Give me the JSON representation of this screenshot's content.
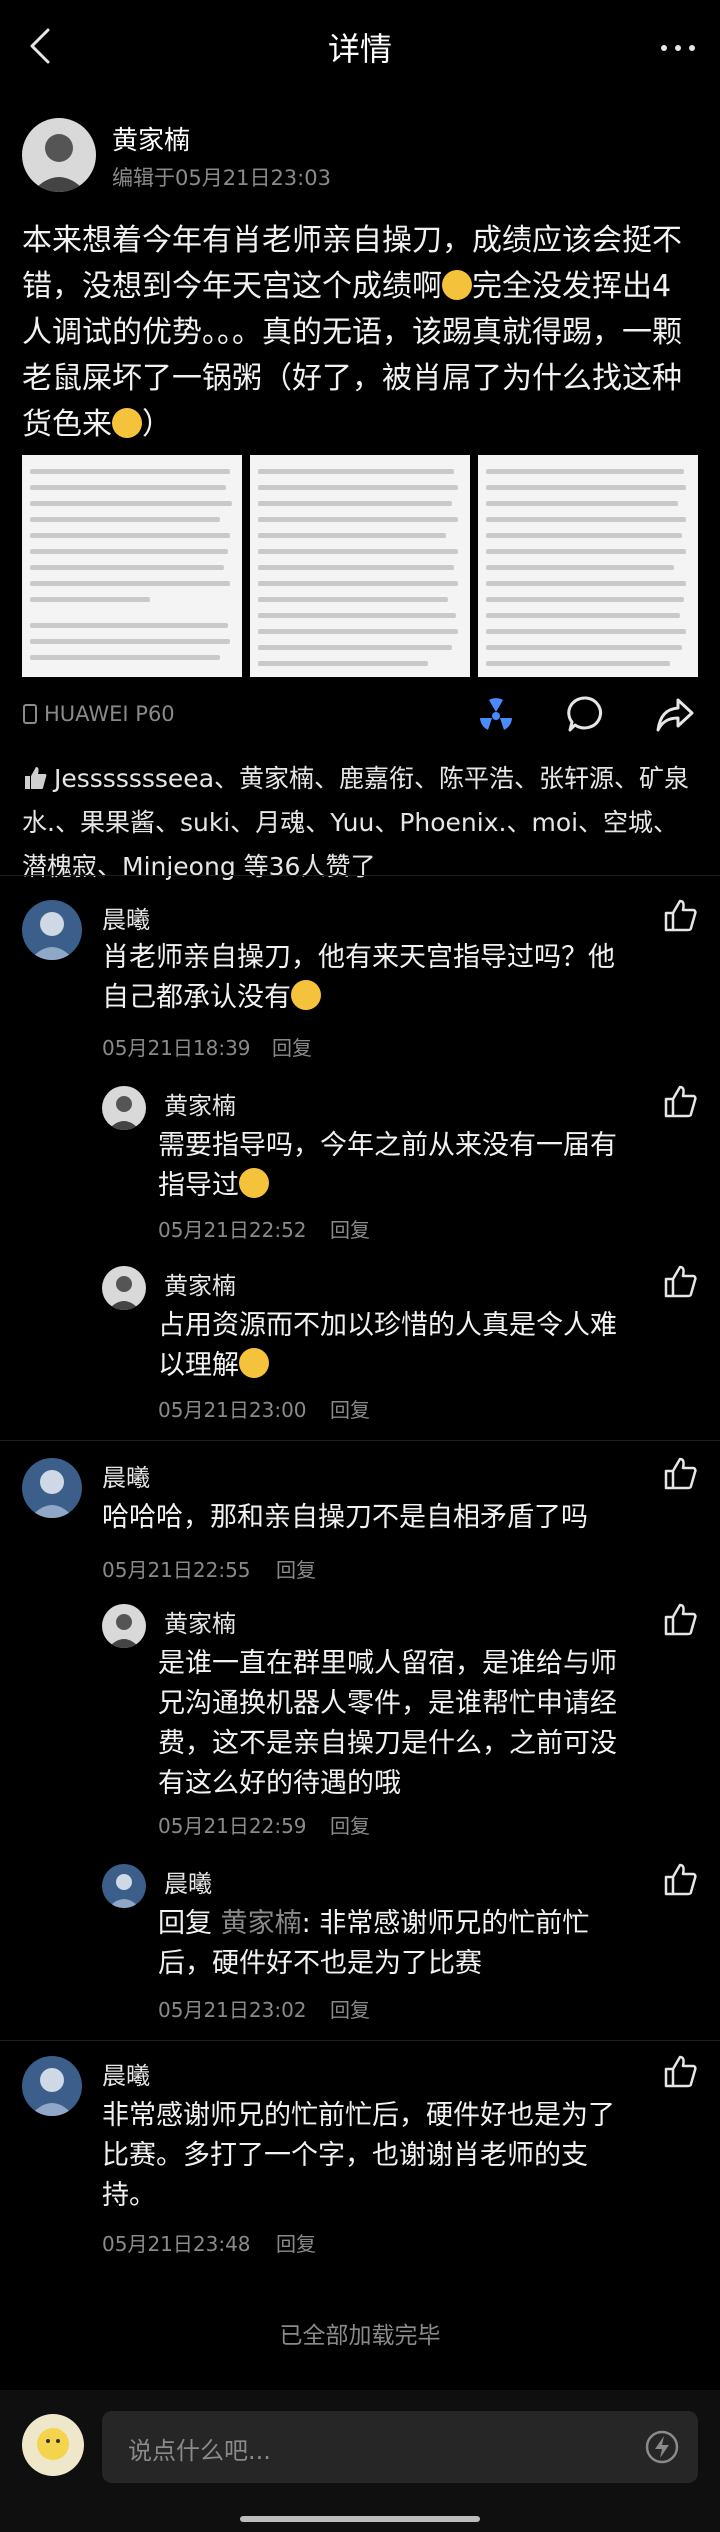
{
  "header": {
    "title": "详情"
  },
  "post": {
    "author": "黄家楠",
    "edited": "编辑于05月21日23:03",
    "text1": "本来想着今年有肖老师亲自操刀，成绩应该会挺不错，没想到今年天宫这个成绩啊",
    "text2": "完全没发挥出4人调试的优势。。。真的无语，该踢真就得踢，一颗老鼠屎坏了一锅粥（好了，被肖屌了为什么找这种货色来",
    "text3": "）",
    "device": "HUAWEI P60",
    "likes": "Jessssssseea、黄家楠、鹿嘉衔、陈平浩、张轩源、矿泉水.、果果酱、suki、月魂、Yuu、Phoenix.、moi、空城、潜槐寂、Minjeong 等36人赞了"
  },
  "comments": [
    {
      "name": "晨曦",
      "text": "肖老师亲自操刀，他有来天宫指导过吗？他自己都承认没有",
      "time": "05月21日18:39",
      "reply": "回复"
    },
    {
      "name": "黄家楠",
      "text": "需要指导吗，今年之前从来没有一届有指导过",
      "time": "05月21日22:52",
      "reply": "回复"
    },
    {
      "name": "黄家楠",
      "text": "占用资源而不加以珍惜的人真是令人难以理解",
      "time": "05月21日23:00",
      "reply": "回复"
    },
    {
      "name": "晨曦",
      "text": "哈哈哈，那和亲自操刀不是自相矛盾了吗",
      "time": "05月21日22:55",
      "reply": "回复"
    },
    {
      "name": "黄家楠",
      "text": "是谁一直在群里喊人留宿，是谁给与师兄沟通换机器人零件，是谁帮忙申请经费，这不是亲自操刀是什么，之前可没有这么好的待遇的哦",
      "time": "05月21日22:59",
      "reply": "回复"
    },
    {
      "name": "晨曦",
      "prefix": "回复",
      "target": "黄家楠",
      "text": ": 非常感谢师兄的忙前忙后，硬件好不也是为了比赛",
      "time": "05月21日23:02",
      "reply": "回复"
    },
    {
      "name": "晨曦",
      "text": "非常感谢师兄的忙前忙后，硬件好也是为了比赛。多打了一个字，也谢谢肖老师的支持。",
      "time": "05月21日23:48",
      "reply": "回复"
    }
  ],
  "footer": {
    "done": "已全部加载完毕",
    "input_placeholder": "说点什么吧..."
  },
  "colors": {
    "bg": "#000000",
    "muted": "#8a8a8a",
    "accent": "#4a8cff"
  }
}
